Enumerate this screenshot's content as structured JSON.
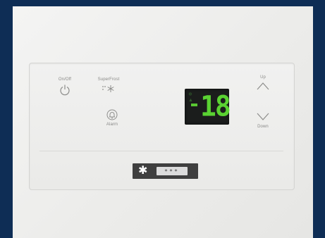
{
  "buttons": {
    "onoff": {
      "label": "On/Off",
      "icon": "power-icon"
    },
    "superfrost": {
      "label": "SuperFrost",
      "icon": "snowflake-icon"
    },
    "alarm": {
      "label": "Alarm",
      "icon": "bell-icon"
    },
    "up": {
      "label": "Up",
      "icon": "chevron-up-icon"
    },
    "down": {
      "label": "Down",
      "icon": "chevron-down-icon"
    }
  },
  "display": {
    "sign": "-",
    "digits": "18",
    "color": "#5ad232"
  },
  "mode_indicator": {
    "icon": "snowflake-icon",
    "stars": "***"
  }
}
